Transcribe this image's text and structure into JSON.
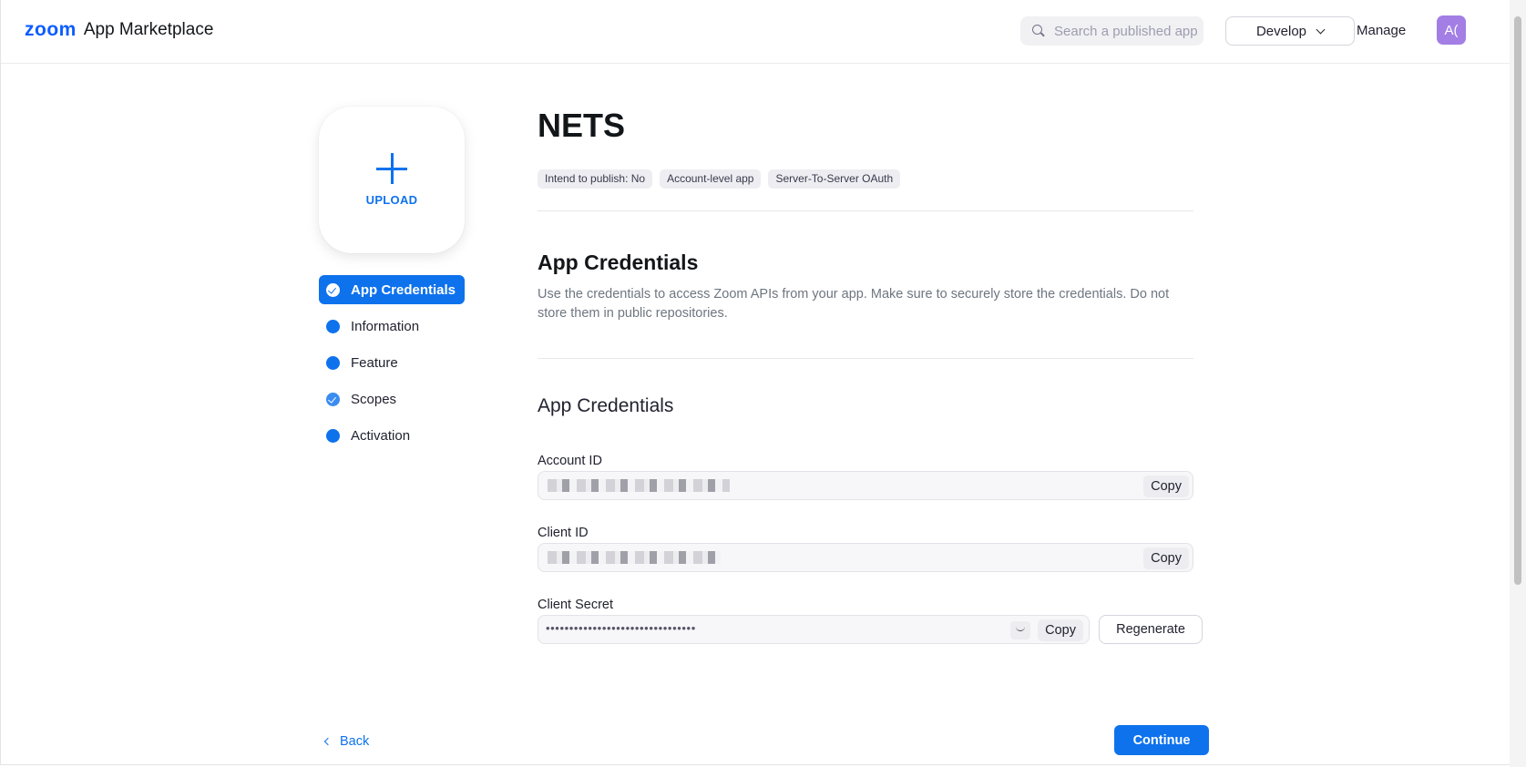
{
  "header": {
    "brand_zoom": "zoom",
    "brand_name": "App Marketplace",
    "search_placeholder": "Search a published app",
    "develop_label": "Develop",
    "manage_label": "Manage",
    "avatar_initials": "A("
  },
  "sidebar": {
    "upload_label": "UPLOAD",
    "items": [
      {
        "label": "App Credentials",
        "active": true,
        "status": "checked"
      },
      {
        "label": "Information",
        "active": false,
        "status": "dot"
      },
      {
        "label": "Feature",
        "active": false,
        "status": "dot"
      },
      {
        "label": "Scopes",
        "active": false,
        "status": "checked"
      },
      {
        "label": "Activation",
        "active": false,
        "status": "dot"
      }
    ]
  },
  "app": {
    "name": "NETS",
    "tags": [
      "Intend to publish: No",
      "Account-level app",
      "Server-To-Server OAuth"
    ]
  },
  "credentials": {
    "section_title": "App Credentials",
    "section_desc": "Use the credentials to access Zoom APIs from your app. Make sure to securely store the credentials. Do not store them in public repositories.",
    "sub_title": "App Credentials",
    "account_id_label": "Account ID",
    "client_id_label": "Client ID",
    "client_secret_label": "Client Secret",
    "client_secret_masked": "••••••••••••••••••••••••••••••••",
    "copy_label": "Copy",
    "regenerate_label": "Regenerate"
  },
  "footer": {
    "back_label": "Back",
    "continue_label": "Continue"
  },
  "colors": {
    "accent": "#0e72ed",
    "brand": "#0b5cff",
    "avatar": "#a37ee4"
  }
}
